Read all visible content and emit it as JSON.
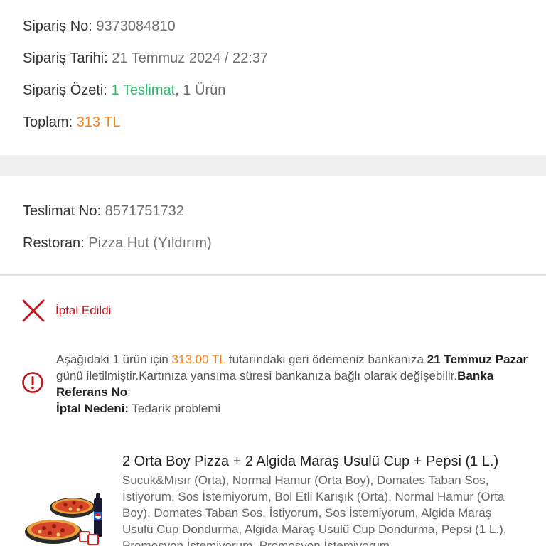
{
  "order": {
    "order_no_label": "Sipariş No:",
    "order_no": "9373084810",
    "order_date_label": "Sipariş Tarihi:",
    "order_date": "21 Temmuz 2024 / 22:37",
    "summary_label": "Sipariş Özeti:",
    "summary_delivery": "1 Teslimat",
    "summary_sep": ",",
    "summary_items": "1 Ürün",
    "total_label": "Toplam:",
    "total": "313 TL"
  },
  "delivery": {
    "delivery_no_label": "Teslimat No:",
    "delivery_no": "8571751732",
    "restaurant_label": "Restoran:",
    "restaurant": "Pizza Hut (Yıldırım)"
  },
  "status": {
    "icon": "close-icon",
    "text": "İptal Edildi",
    "color": "#c0161d"
  },
  "refund_notice": {
    "icon": "info-circle-icon",
    "part1": "Aşağıdaki 1 ürün için ",
    "amount": "313.00 TL",
    "part2": " tutarındaki geri ödemeniz bankanıza ",
    "date": "21 Temmuz Pazar",
    "part3": " günü iletilmiştir.Kartınıza yansıma süresi bankanıza bağlı olarak değişebilir.",
    "bank_ref_label": "Banka Referans No",
    "bank_ref_suffix": ":",
    "reason_label": "İptal Nedeni:",
    "reason": " Tedarik problemi"
  },
  "product": {
    "title": "2 Orta Boy Pizza + 2 Algida Maraş Usulü Cup + Pepsi (1 L.)",
    "description": "Sucuk&Mısır (Orta), Normal Hamur (Orta Boy), Domates Taban Sos, İstiyorum, Sos İstemiyorum, Bol Etli Karışık (Orta), Normal Hamur (Orta Boy), Domates Taban Sos, İstiyorum, Sos İstemiyorum, Algida Maraş Usulü Cup Dondurma, Algida Maraş Usulü Cup Dondurma, Pepsi (1 L.), Promosyon İstemiyorum, Promosyon İstemiyorum"
  },
  "colors": {
    "green": "#2cb86a",
    "orange": "#f0821e",
    "red": "#c0161d",
    "separator": "#efefef"
  }
}
